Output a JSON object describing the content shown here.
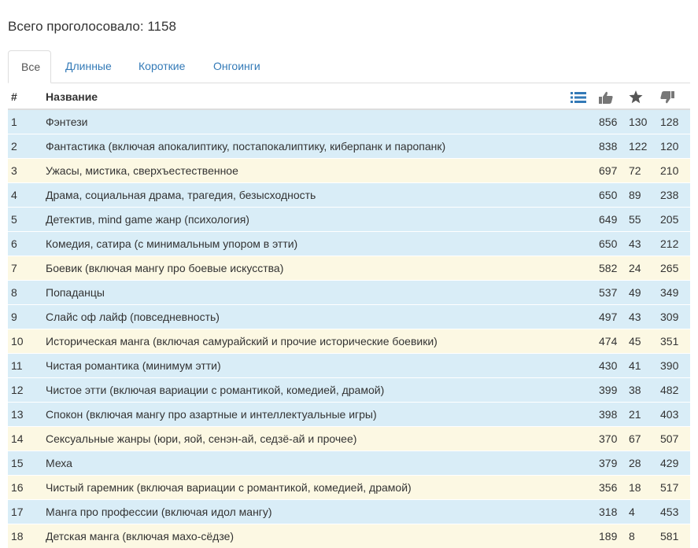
{
  "summary": {
    "total_text": "Всего проголосовало: 1158"
  },
  "tabs": [
    {
      "label": "Все",
      "active": true
    },
    {
      "label": "Длинные",
      "active": false
    },
    {
      "label": "Короткие",
      "active": false
    },
    {
      "label": "Онгоинги",
      "active": false
    }
  ],
  "table": {
    "headers": {
      "num": "#",
      "name": "Название"
    },
    "header_icons": [
      "list-icon",
      "thumbs-up-icon",
      "star-icon",
      "thumbs-down-icon"
    ],
    "row_colors": {
      "blue": "#d9edf7",
      "yellow": "#fcf8e3"
    },
    "rows": [
      {
        "num": "1",
        "name": "Фэнтези",
        "likes": "856",
        "favs": "130",
        "dislikes": "128",
        "color": "blue"
      },
      {
        "num": "2",
        "name": "Фантастика (включая апокалиптику, постапокалиптику, киберпанк и паропанк)",
        "likes": "838",
        "favs": "122",
        "dislikes": "120",
        "color": "blue"
      },
      {
        "num": "3",
        "name": "Ужасы, мистика, сверхъестественное",
        "likes": "697",
        "favs": "72",
        "dislikes": "210",
        "color": "yellow"
      },
      {
        "num": "4",
        "name": "Драма, социальная драма, трагедия, безысходность",
        "likes": "650",
        "favs": "89",
        "dislikes": "238",
        "color": "blue"
      },
      {
        "num": "5",
        "name": "Детектив, mind game жанр (психология)",
        "likes": "649",
        "favs": "55",
        "dislikes": "205",
        "color": "blue"
      },
      {
        "num": "6",
        "name": "Комедия, сатира (с минимальным упором в этти)",
        "likes": "650",
        "favs": "43",
        "dislikes": "212",
        "color": "blue"
      },
      {
        "num": "7",
        "name": "Боевик (включая мангу про боевые искусства)",
        "likes": "582",
        "favs": "24",
        "dislikes": "265",
        "color": "yellow"
      },
      {
        "num": "8",
        "name": "Попаданцы",
        "likes": "537",
        "favs": "49",
        "dislikes": "349",
        "color": "blue"
      },
      {
        "num": "9",
        "name": "Слайс оф лайф (повседневность)",
        "likes": "497",
        "favs": "43",
        "dislikes": "309",
        "color": "blue"
      },
      {
        "num": "10",
        "name": "Историческая манга (включая самурайский и прочие исторические боевики)",
        "likes": "474",
        "favs": "45",
        "dislikes": "351",
        "color": "yellow"
      },
      {
        "num": "11",
        "name": "Чистая романтика (минимум этти)",
        "likes": "430",
        "favs": "41",
        "dislikes": "390",
        "color": "blue"
      },
      {
        "num": "12",
        "name": "Чистое этти (включая вариации с романтикой, комедией, драмой)",
        "likes": "399",
        "favs": "38",
        "dislikes": "482",
        "color": "blue"
      },
      {
        "num": "13",
        "name": "Спокон (включая мангу про азартные и интеллектуальные игры)",
        "likes": "398",
        "favs": "21",
        "dislikes": "403",
        "color": "blue"
      },
      {
        "num": "14",
        "name": "Сексуальные жанры (юри, яой, сенэн-ай, седзё-ай и прочее)",
        "likes": "370",
        "favs": "67",
        "dislikes": "507",
        "color": "yellow"
      },
      {
        "num": "15",
        "name": "Меха",
        "likes": "379",
        "favs": "28",
        "dislikes": "429",
        "color": "blue"
      },
      {
        "num": "16",
        "name": "Чистый гаремник (включая вариации с романтикой, комедией, драмой)",
        "likes": "356",
        "favs": "18",
        "dislikes": "517",
        "color": "yellow"
      },
      {
        "num": "17",
        "name": "Манга про профессии (включая идол мангу)",
        "likes": "318",
        "favs": "4",
        "dislikes": "453",
        "color": "blue"
      },
      {
        "num": "18",
        "name": "Детская манга (включая махо-сёдзе)",
        "likes": "189",
        "favs": "8",
        "dislikes": "581",
        "color": "yellow"
      }
    ]
  }
}
